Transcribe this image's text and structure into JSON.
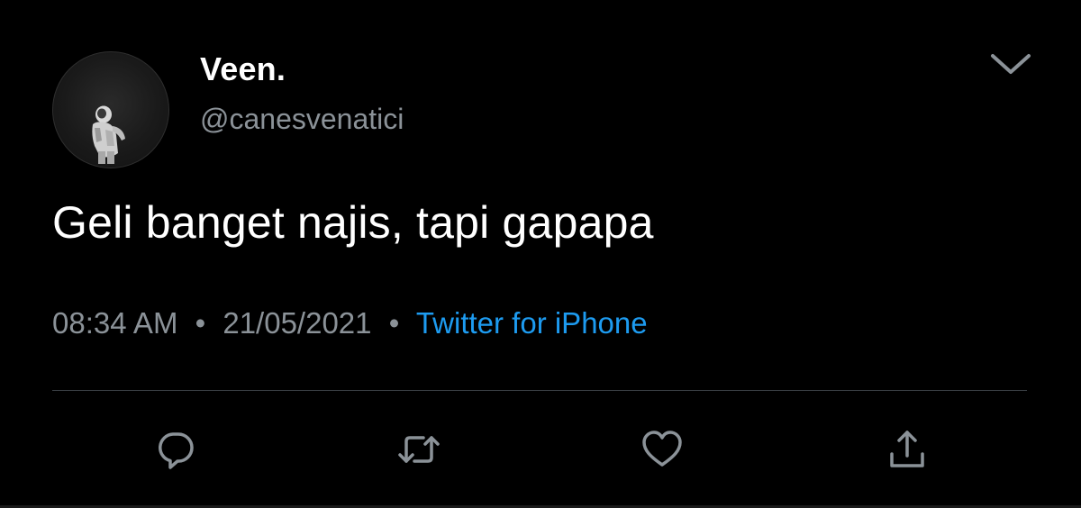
{
  "tweet": {
    "author": {
      "display_name": "Veen.",
      "handle": "@canesvenatici"
    },
    "text": "Geli banget najis, tapi gapapa",
    "meta": {
      "time": "08:34 AM",
      "separator": "•",
      "date": "21/05/2021",
      "source": "Twitter for iPhone"
    }
  },
  "icons": {
    "menu": "chevron-down-icon",
    "reply": "reply-icon",
    "retweet": "retweet-icon",
    "like": "heart-icon",
    "share": "share-icon"
  },
  "colors": {
    "background": "#000000",
    "text": "#ffffff",
    "muted": "#8b9298",
    "link": "#1d9bf0"
  }
}
